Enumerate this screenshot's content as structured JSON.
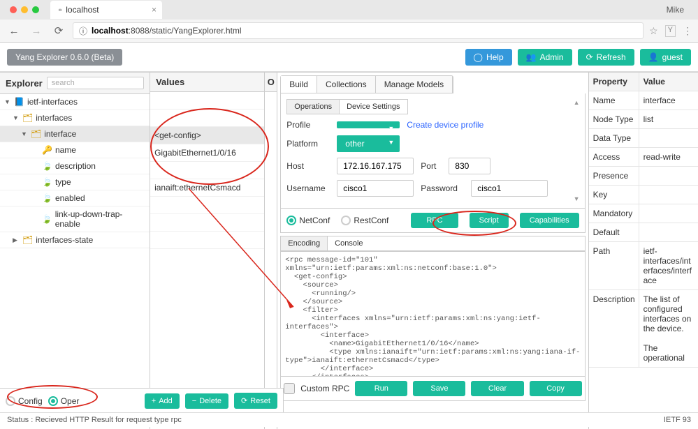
{
  "browser": {
    "tab_title": "localhost",
    "user": "Mike",
    "url_prefix": "localhost",
    "url_rest": ":8088/static/YangExplorer.html"
  },
  "header": {
    "app_title": "Yang Explorer 0.6.0 (Beta)",
    "help": "Help",
    "admin": "Admin",
    "refresh": "Refresh",
    "guest": "guest"
  },
  "explorer": {
    "title": "Explorer",
    "search_placeholder": "search",
    "values_title": "Values",
    "o_title": "O",
    "tree": [
      {
        "label": "ietf-interfaces",
        "icon": "book",
        "arrow": "▼",
        "indent": 0
      },
      {
        "label": "interfaces",
        "icon": "folder",
        "arrow": "▼",
        "indent": 1
      },
      {
        "label": "interface",
        "icon": "folder",
        "arrow": "▼",
        "indent": 2,
        "sel": true
      },
      {
        "label": "name",
        "icon": "key",
        "indent": 3
      },
      {
        "label": "description",
        "icon": "leaf",
        "indent": 3
      },
      {
        "label": "type",
        "icon": "leaf-red",
        "indent": 3
      },
      {
        "label": "enabled",
        "icon": "leaf",
        "indent": 3
      },
      {
        "label": "link-up-down-trap-enable",
        "icon": "leaf",
        "indent": 3
      },
      {
        "label": "interfaces-state",
        "icon": "folder",
        "arrow": "▶",
        "indent": 1
      }
    ],
    "values": [
      "",
      "",
      "<get-config>",
      "GigabitEthernet1/0/16",
      "",
      "ianaift:ethernetCsmacd",
      "",
      "",
      ""
    ],
    "config_label": "Config",
    "oper_label": "Oper",
    "add": "Add",
    "delete": "Delete",
    "reset": "Reset"
  },
  "center": {
    "top_tabs": [
      "Build",
      "Collections",
      "Manage Models"
    ],
    "sub_tabs": [
      "Operations",
      "Device Settings"
    ],
    "profile_label": "Profile",
    "profile_value": "",
    "create_profile": "Create device profile",
    "platform_label": "Platform",
    "platform_value": "other",
    "host_label": "Host",
    "host_value": "172.16.167.175",
    "port_label": "Port",
    "port_value": "830",
    "username_label": "Username",
    "username_value": "cisco1",
    "password_label": "Password",
    "password_value": "cisco1",
    "netconf": "NetConf",
    "restconf": "RestConf",
    "rpc": "RPC",
    "script": "Script",
    "capabilities": "Capabilities",
    "code_tabs": [
      "Encoding",
      "Console"
    ],
    "rpc_xml": "<rpc message-id=\"101\"\nxmlns=\"urn:ietf:params:xml:ns:netconf:base:1.0\">\n  <get-config>\n    <source>\n      <running/>\n    </source>\n    <filter>\n      <interfaces xmlns=\"urn:ietf:params:xml:ns:yang:ietf-\ninterfaces\">\n        <interface>\n          <name>GigabitEthernet1/0/16</name>\n          <type xmlns:ianaift=\"urn:ietf:params:xml:ns:yang:iana-if-\ntype\">ianaift:ethernetCsmacd</type>\n        </interface>\n      </interfaces>",
    "custom_rpc": "Custom RPC",
    "run": "Run",
    "save": "Save",
    "clear": "Clear",
    "copy": "Copy"
  },
  "props": {
    "header_key": "Property",
    "header_val": "Value",
    "rows": [
      {
        "k": "Name",
        "v": "interface"
      },
      {
        "k": "Node Type",
        "v": "list"
      },
      {
        "k": "Data Type",
        "v": ""
      },
      {
        "k": "Access",
        "v": "read-write"
      },
      {
        "k": "Presence",
        "v": ""
      },
      {
        "k": "Key",
        "v": ""
      },
      {
        "k": "Mandatory",
        "v": ""
      },
      {
        "k": "Default",
        "v": ""
      },
      {
        "k": "Path",
        "v": "ietf-interfaces/interfaces/interface"
      },
      {
        "k": "Description",
        "v": "The list of configured interfaces on the device.\n\nThe operational"
      }
    ]
  },
  "status": {
    "text": "Status : Recieved HTTP Result for request type rpc",
    "right": "IETF 93"
  }
}
